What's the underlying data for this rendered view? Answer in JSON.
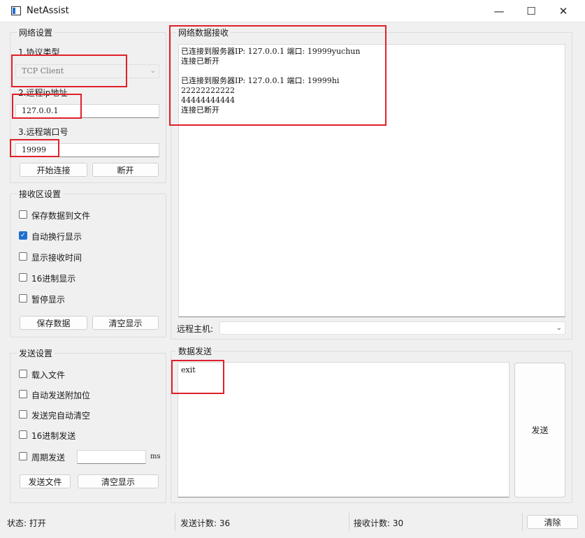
{
  "window": {
    "title": "NetAssist"
  },
  "network_settings": {
    "title": "网络设置",
    "protocol_label": "1.协议类型",
    "protocol_value": "TCP Client",
    "ip_label": "2.远程ip地址",
    "ip_value": "127.0.0.1",
    "port_label": "3.远程端口号",
    "port_value": "19999",
    "connect_button": "开始连接",
    "disconnect_button": "断开"
  },
  "receive_settings": {
    "title": "接收区设置",
    "options": [
      {
        "label": "保存数据到文件",
        "checked": false
      },
      {
        "label": "自动换行显示",
        "checked": true
      },
      {
        "label": "显示接收时间",
        "checked": false
      },
      {
        "label": "16进制显示",
        "checked": false
      },
      {
        "label": "暂停显示",
        "checked": false
      }
    ],
    "save_button": "保存数据",
    "clear_button": "清空显示"
  },
  "send_settings": {
    "title": "发送设置",
    "options": [
      {
        "label": "载入文件",
        "checked": false
      },
      {
        "label": "自动发送附加位",
        "checked": false
      },
      {
        "label": "发送完自动清空",
        "checked": false
      },
      {
        "label": "16进制发送",
        "checked": false
      },
      {
        "label": "周期发送",
        "checked": false
      }
    ],
    "period_unit": "ms",
    "send_file_button": "发送文件",
    "clear_button": "清空显示"
  },
  "receive_area": {
    "title": "网络数据接收",
    "lines": [
      "已连接到服务器IP: 127.0.0.1 端口: 19999yuchun",
      "连接已断开",
      "",
      "已连接到服务器IP: 127.0.0.1 端口: 19999hi",
      "22222222222",
      "44444444444",
      "连接已断开"
    ],
    "remote_host_label": "远程主机:"
  },
  "send_area": {
    "title": "数据发送",
    "text": "exit",
    "send_button": "发送"
  },
  "status_bar": {
    "state": "状态: 打开",
    "send_count": "发送计数: 36",
    "recv_count": "接收计数: 30",
    "clear_button": "清除"
  },
  "colors": {
    "annotation": "#e0202a",
    "accent": "#1f6fd0"
  }
}
